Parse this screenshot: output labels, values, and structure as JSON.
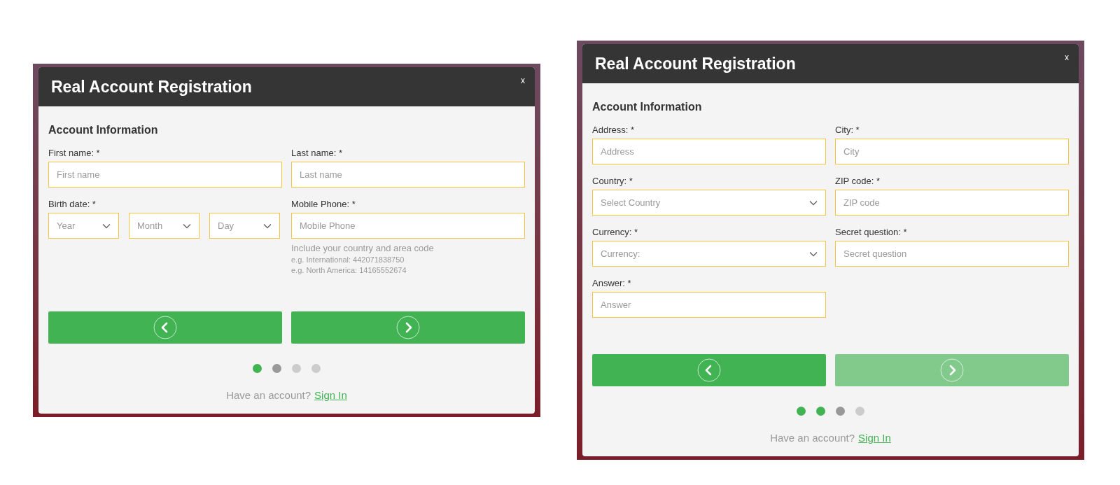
{
  "panels": [
    {
      "title": "Real Account Registration",
      "close": "x",
      "section": "Account Information",
      "fields": [
        {
          "kind": "input",
          "label": "First name: *",
          "placeholder": "First name"
        },
        {
          "kind": "input",
          "label": "Last name: *",
          "placeholder": "Last name"
        },
        {
          "kind": "date",
          "label": "Birth date: *",
          "parts": [
            {
              "placeholder": "Year"
            },
            {
              "placeholder": "Month"
            },
            {
              "placeholder": "Day"
            }
          ]
        },
        {
          "kind": "input",
          "label": "Mobile Phone: *",
          "placeholder": "Mobile Phone",
          "hint": "Include your country and area code",
          "examples": [
            "e.g. International: 442071838750",
            "e.g. North America: 14165552674"
          ]
        }
      ],
      "prev": {
        "disabled": false
      },
      "next": {
        "disabled": false
      },
      "steps": [
        {
          "color": "#41b352"
        },
        {
          "color": "#999999"
        },
        {
          "color": "#cccccc"
        },
        {
          "color": "#cccccc"
        }
      ],
      "footer": {
        "text": "Have an account?",
        "link": "Sign In"
      }
    },
    {
      "title": "Real Account Registration",
      "close": "x",
      "section": "Account Information",
      "fields": [
        {
          "kind": "input",
          "label": "Address: *",
          "placeholder": "Address"
        },
        {
          "kind": "input",
          "label": "City: *",
          "placeholder": "City"
        },
        {
          "kind": "select",
          "label": "Country: *",
          "placeholder": "Select Country"
        },
        {
          "kind": "input",
          "label": "ZIP code: *",
          "placeholder": "ZIP code"
        },
        {
          "kind": "select",
          "label": "Currency: *",
          "placeholder": "Currency:"
        },
        {
          "kind": "input",
          "label": "Secret question: *",
          "placeholder": "Secret question"
        },
        {
          "kind": "input",
          "label": "Answer: *",
          "placeholder": "Answer"
        }
      ],
      "prev": {
        "disabled": false
      },
      "next": {
        "disabled": true
      },
      "steps": [
        {
          "color": "#41b352"
        },
        {
          "color": "#41b352"
        },
        {
          "color": "#999999"
        },
        {
          "color": "#cccccc"
        }
      ],
      "footer": {
        "text": "Have an account?",
        "link": "Sign In"
      }
    }
  ]
}
